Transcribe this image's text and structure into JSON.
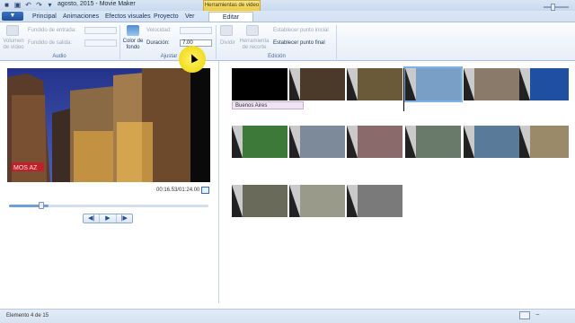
{
  "window": {
    "title": "agosto, 2015 - Movie Maker",
    "context_tab_header": "Herramientas de video"
  },
  "tabs": {
    "file_label": "▼",
    "items": [
      {
        "label": "Principal"
      },
      {
        "label": "Animaciones"
      },
      {
        "label": "Efectos visuales"
      },
      {
        "label": "Proyecto"
      },
      {
        "label": "Ver"
      },
      {
        "label": "Editar"
      }
    ]
  },
  "ribbon": {
    "audio": {
      "video_volume": "Volumen de vídeo",
      "fade_in": "Fundido de entrada:",
      "fade_out": "Fundido de salida:",
      "group": "Audio"
    },
    "adjust": {
      "bg_color": "Color de fondo",
      "speed": "Velocidad:",
      "duration": "Duración:",
      "duration_value": "7.00",
      "group": "Ajustar"
    },
    "edit": {
      "split": "Dividir",
      "trim_tool": "Herramienta de recorte",
      "set_start": "Establecer punto inicial",
      "set_end": "Establecer punto final",
      "group": "Edición"
    }
  },
  "player": {
    "time": "00:16.53/01:24.00",
    "progress_fraction": 0.2,
    "controls": [
      "◀|",
      "▶",
      "|▶"
    ]
  },
  "storyboard": {
    "caption": "Buenos Aires"
  },
  "status": {
    "text": "Elemento 4 de 15"
  }
}
